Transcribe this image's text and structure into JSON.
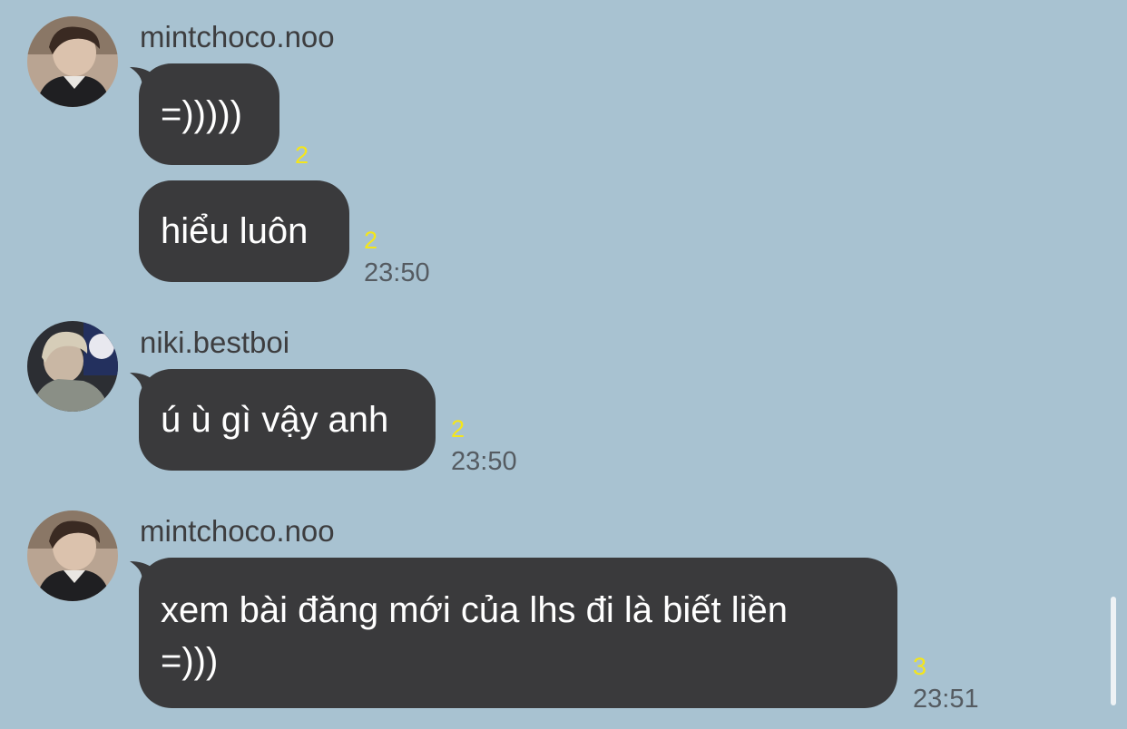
{
  "theme": {
    "background": "#a8c2d1",
    "bubble": "#3a3a3c",
    "bubble_text": "#ffffff",
    "read_count": "#f5e61a",
    "time": "#555b61",
    "sender": "#3d3d3f"
  },
  "messages": [
    {
      "sender": "mintchoco.noo",
      "avatar_icon": "user-photo-avatar-icon",
      "bubbles": [
        {
          "text": "=)))))",
          "read_count": "2",
          "time": ""
        },
        {
          "text": "hiểu luôn",
          "read_count": "2",
          "time": "23:50"
        }
      ]
    },
    {
      "sender": "niki.bestboi",
      "avatar_icon": "user-photo-avatar-icon",
      "bubbles": [
        {
          "text": "ú ù gì vậy anh",
          "read_count": "2",
          "time": "23:50"
        }
      ]
    },
    {
      "sender": "mintchoco.noo",
      "avatar_icon": "user-photo-avatar-icon",
      "bubbles": [
        {
          "text": "xem bài đăng mới của lhs đi là biết liền\n=)))",
          "read_count": "3",
          "time": "23:51"
        }
      ]
    }
  ]
}
